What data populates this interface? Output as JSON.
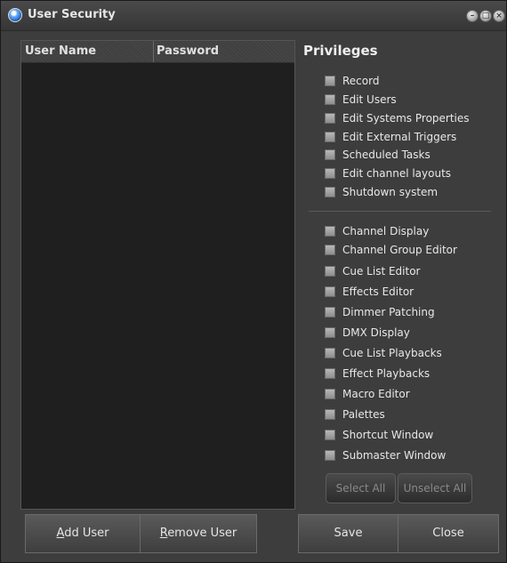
{
  "window": {
    "title": "User Security",
    "controls": [
      "minimize-icon",
      "maximize-icon",
      "close-icon"
    ]
  },
  "users_table": {
    "columns": [
      "User Name",
      "Password"
    ],
    "rows": []
  },
  "privileges": {
    "title": "Privileges",
    "group1": [
      "Record",
      "Edit Users",
      "Edit Systems Properties",
      "Edit External Triggers",
      "Scheduled Tasks",
      "Edit channel layouts",
      "Shutdown system"
    ],
    "group2": [
      "Channel Display",
      "Channel Group Editor",
      "Cue List Editor",
      "Effects Editor",
      "Dimmer Patching",
      "DMX Display",
      "Cue List Playbacks",
      "Effect Playbacks",
      "Macro Editor",
      "Palettes",
      "Shortcut Window",
      "Submaster Window"
    ],
    "select_all": "Select All",
    "unselect_all": "Unselect All"
  },
  "buttons": {
    "add_user": {
      "mnemonic": "A",
      "rest": "dd User"
    },
    "remove_user": {
      "mnemonic": "R",
      "rest": "emove User"
    },
    "save": "Save",
    "close": "Close"
  }
}
